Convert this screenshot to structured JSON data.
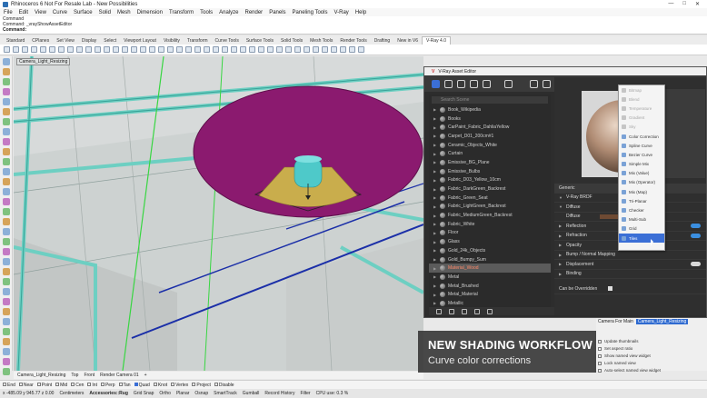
{
  "window": {
    "title": "Rhinoceros 6 Not For Resale Lab - New Possibilities",
    "controls": [
      "—",
      "□",
      "✕"
    ]
  },
  "menu": [
    "File",
    "Edit",
    "View",
    "Curve",
    "Surface",
    "Solid",
    "Mesh",
    "Dimension",
    "Transform",
    "Tools",
    "Analyze",
    "Render",
    "Panels",
    "Paneling Tools",
    "V-Ray",
    "Help"
  ],
  "command": {
    "line1": "Command",
    "line2": "Command: _vrayShowAssetEditor",
    "prompt": "Command:"
  },
  "toolbar_tabs": [
    "Standard",
    "CPlanes",
    "Set View",
    "Display",
    "Select",
    "Viewport Layout",
    "Visibility",
    "Transform",
    "Curve Tools",
    "Surface Tools",
    "Solid Tools",
    "Mesh Tools",
    "Render Tools",
    "Drafting",
    "New in V6",
    "V-Ray 4.0"
  ],
  "viewport": {
    "label": "Camera_Light_Resizing",
    "bottom_tabs": [
      "Camera_Light_Resizing",
      "Top",
      "Front",
      "Render Camera 01",
      "+"
    ]
  },
  "vray": {
    "title": "V-Ray Asset Editor",
    "search_placeholder": "Search Scene",
    "assets": [
      "Book_Wikipedia",
      "Books",
      "CarPaint_Fabric_DahliaYellow",
      "Carpet_D01_200cm#1",
      "Ceramic_Objects_White",
      "Curtain",
      "Emissive_BG_Plane",
      "Emissive_Bulbs",
      "Fabric_D03_Yellow_10cm",
      "Fabric_DarkGreen_Backrest",
      "Fabric_Green_Seat",
      "Fabric_LightGreen_Backrest",
      "Fabric_MediumGreen_Backrest",
      "Fabric_White",
      "Floor",
      "Glass",
      "Gold_24k_Objects",
      "Gold_Bumpy_Sum",
      "Material_Wood",
      "Metal",
      "Metal_Brushed",
      "Metal_Material",
      "Metallic"
    ],
    "selected_asset": "Material_Wood",
    "props": {
      "generic": "Generic",
      "brdf": "V-Ray BRDF",
      "diffuse_head": "Diffuse",
      "diffuse": "Diffuse",
      "reflection": "Reflection",
      "refraction": "Refraction",
      "opacity": "Opacity",
      "bump": "Bump / Normal Mapping",
      "displacement": "Displacement",
      "binding": "Binding",
      "override": "Can be Overridden"
    }
  },
  "dropdown": {
    "items": [
      {
        "label": "Bitmap",
        "state": "disabled"
      },
      {
        "label": "Blend",
        "state": "disabled"
      },
      {
        "label": "Temperature",
        "state": "disabled"
      },
      {
        "label": "Gradient",
        "state": "disabled"
      },
      {
        "label": "Sky",
        "state": "disabled"
      },
      {
        "label": "Color Correction",
        "state": "normal"
      },
      {
        "label": "Spline Curve",
        "state": "normal"
      },
      {
        "label": "Bezier Curve",
        "state": "normal"
      },
      {
        "label": "Simple Mix",
        "state": "normal"
      },
      {
        "label": "Mix (Value)",
        "state": "normal"
      },
      {
        "label": "Mix (Operator)",
        "state": "normal"
      },
      {
        "label": "Mix (Map)",
        "state": "normal"
      },
      {
        "label": "Tri-Planar",
        "state": "normal"
      },
      {
        "label": "Checker",
        "state": "normal"
      },
      {
        "label": "Multi-Sub",
        "state": "normal"
      },
      {
        "label": "Grid",
        "state": "normal"
      },
      {
        "label": "Tiles",
        "state": "highlighted"
      }
    ]
  },
  "named_views": {
    "camera_label": "Camera For Main",
    "camera_value": "Camera_Light_Resizing",
    "checks": [
      "Update thumbnails",
      "Set aspect ratio",
      "Show named view widget",
      "Lock named view",
      "Auto-select named view widget"
    ]
  },
  "banner": {
    "heading": "NEW SHADING WORKFLOW",
    "sub": "Curve color corrections"
  },
  "osnap": [
    {
      "label": "End",
      "on": false
    },
    {
      "label": "Near",
      "on": false
    },
    {
      "label": "Point",
      "on": false
    },
    {
      "label": "Mid",
      "on": false
    },
    {
      "label": "Cen",
      "on": false
    },
    {
      "label": "Int",
      "on": false
    },
    {
      "label": "Perp",
      "on": false
    },
    {
      "label": "Tan",
      "on": false
    },
    {
      "label": "Quad",
      "on": true
    },
    {
      "label": "Knot",
      "on": false
    },
    {
      "label": "Vertex",
      "on": false
    },
    {
      "label": "Project",
      "on": false
    },
    {
      "label": "Disable",
      "on": false
    }
  ],
  "status": {
    "coords": "x -485.09   y 945.77   z 0.00",
    "units": "Centimeters",
    "layer": "Accessories::Rug",
    "toggles": [
      "Grid Snap",
      "Ortho",
      "Planar",
      "Osnap",
      "SmartTrack",
      "Gumball",
      "Record History"
    ],
    "filter": "Filter",
    "cpu": "CPU use: 0.3 %"
  },
  "colors": {
    "accent": "#3b6fd6",
    "disk": "#8b1a6f",
    "cone": "#c9ad4c",
    "pipes": "#6dcfc2",
    "vray_bg": "#2d2d2d"
  }
}
